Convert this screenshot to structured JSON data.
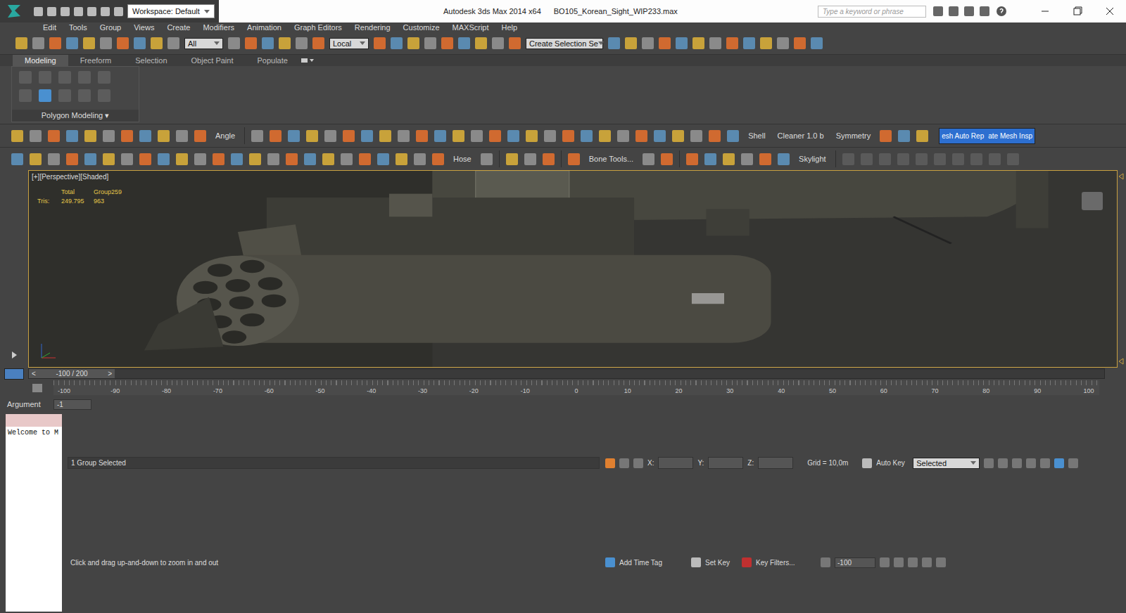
{
  "window": {
    "workspace": "Workspace: Default",
    "title": "Autodesk 3ds Max  2014 x64",
    "file": "BO105_Korean_Sight_WIP233.max",
    "search_placeholder": "Type a keyword or phrase"
  },
  "menu": [
    "Edit",
    "Tools",
    "Group",
    "Views",
    "Create",
    "Modifiers",
    "Animation",
    "Graph Editors",
    "Rendering",
    "Customize",
    "MAXScript",
    "Help"
  ],
  "main_toolbar": {
    "selection_filter": "All",
    "coordinate_system": "Local",
    "named_selection": "Create Selection Se"
  },
  "ribbon": {
    "tabs": [
      {
        "label": "Modeling",
        "selected": true
      },
      {
        "label": "Freeform",
        "selected": false
      },
      {
        "label": "Selection",
        "selected": false
      },
      {
        "label": "Object Paint",
        "selected": false
      },
      {
        "label": "Populate",
        "selected": false
      }
    ],
    "panel_label": "Polygon Modeling ▾"
  },
  "toolbar_1": {
    "labels": [
      "Angle",
      "Shell",
      "Cleaner 1.0 b",
      "Symmetry"
    ],
    "buttons": [
      "esh Auto Rep",
      "ate Mesh Insp"
    ]
  },
  "toolbar_2": {
    "labels": [
      "Hose",
      "Bone Tools...",
      "Skylight"
    ]
  },
  "viewport": {
    "label": "[+][Perspective][Shaded]",
    "stats_headers": [
      "Total",
      "Group259"
    ],
    "stats_label": "Tris:",
    "stats_values": [
      "249.795",
      "963"
    ]
  },
  "time_slider": {
    "prev": "<",
    "frame": "-100 / 200",
    "next": ">"
  },
  "ruler_ticks": [
    "-100",
    "-90",
    "-80",
    "-70",
    "-60",
    "-50",
    "-40",
    "-30",
    "-20",
    "-10",
    "0",
    "10",
    "20",
    "30",
    "40",
    "50",
    "60",
    "70",
    "80",
    "90",
    "100"
  ],
  "argument": {
    "label": "Argument",
    "value": "-1"
  },
  "status": {
    "listener": "Welcome to M",
    "selection": "1 Group Selected",
    "prompt": "Click and drag up-and-down to zoom in and out",
    "x_label": "X:",
    "y_label": "Y:",
    "z_label": "Z:",
    "grid": "Grid = 10,0m",
    "add_time_tag": "Add Time Tag",
    "auto_key": "Auto Key",
    "key_mode": "Selected",
    "set_key": "Set Key",
    "key_filters": "Key Filters...",
    "frame": "-100"
  }
}
